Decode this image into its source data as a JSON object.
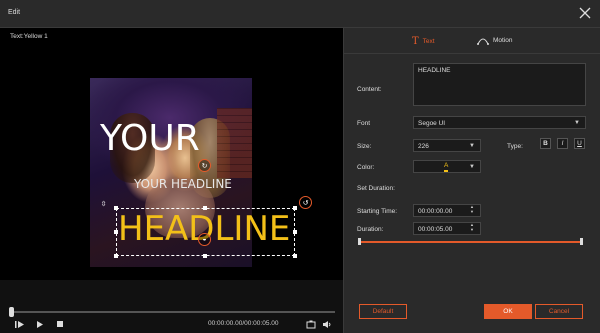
{
  "window": {
    "title": "Edit"
  },
  "preview": {
    "label": "Text:Yellow 1",
    "photo_text_big": "YOUR",
    "photo_text_small": "YOUR HEADLINE",
    "headline_text": "HEADLINE",
    "headline_color": "#f3c018"
  },
  "playback": {
    "timecode": "00:00:00.00/00:00:05.00",
    "progress": 0.0
  },
  "tabs": {
    "text_label": "Text",
    "motion_label": "Motion",
    "active": "Text"
  },
  "form": {
    "content_label": "Content:",
    "content_value": "HEADLINE",
    "font_label": "Font",
    "font_value": "Segoe UI",
    "size_label": "Size:",
    "size_value": "226",
    "type_label": "Type:",
    "bold_label": "B",
    "italic_label": "I",
    "underline_label": "U",
    "color_label": "Color:",
    "color_swatch_letter": "A",
    "color_value": "#f3c018",
    "set_duration_label": "Set Duration:",
    "start_label": "Starting Time:",
    "start_value": "00:00:00.00",
    "duration_label": "Duration:",
    "duration_value": "00:00:05.00"
  },
  "buttons": {
    "default_label": "Default",
    "ok_label": "OK",
    "cancel_label": "Cancel"
  },
  "colors": {
    "accent": "#e45a2a",
    "panel": "#2a2a2a",
    "background": "#1b1b1b"
  }
}
